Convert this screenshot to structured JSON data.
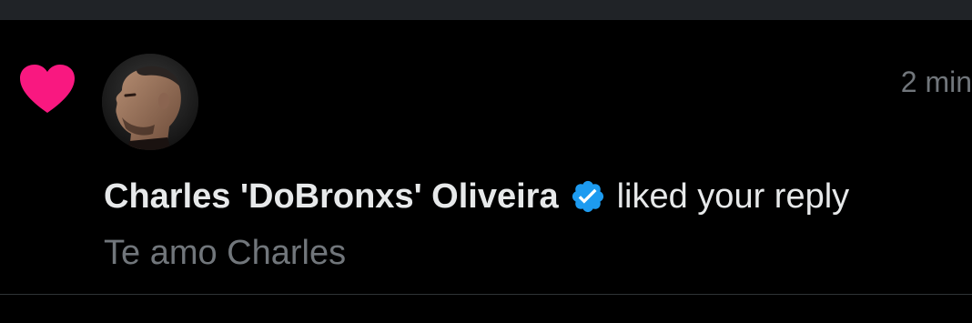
{
  "notification": {
    "type_icon": "heart-icon",
    "avatar": "user-avatar",
    "time": "2 min",
    "user_name": "Charles 'DoBronxs' Oliveira",
    "verified_icon": "verified-badge-icon",
    "action_text": "liked your reply",
    "reply_text": "Te amo Charles"
  },
  "colors": {
    "heart": "#F91880",
    "verified": "#1D9BF0",
    "primary_text": "#E7E9EA",
    "secondary_text": "#71767B",
    "background": "#000000"
  }
}
